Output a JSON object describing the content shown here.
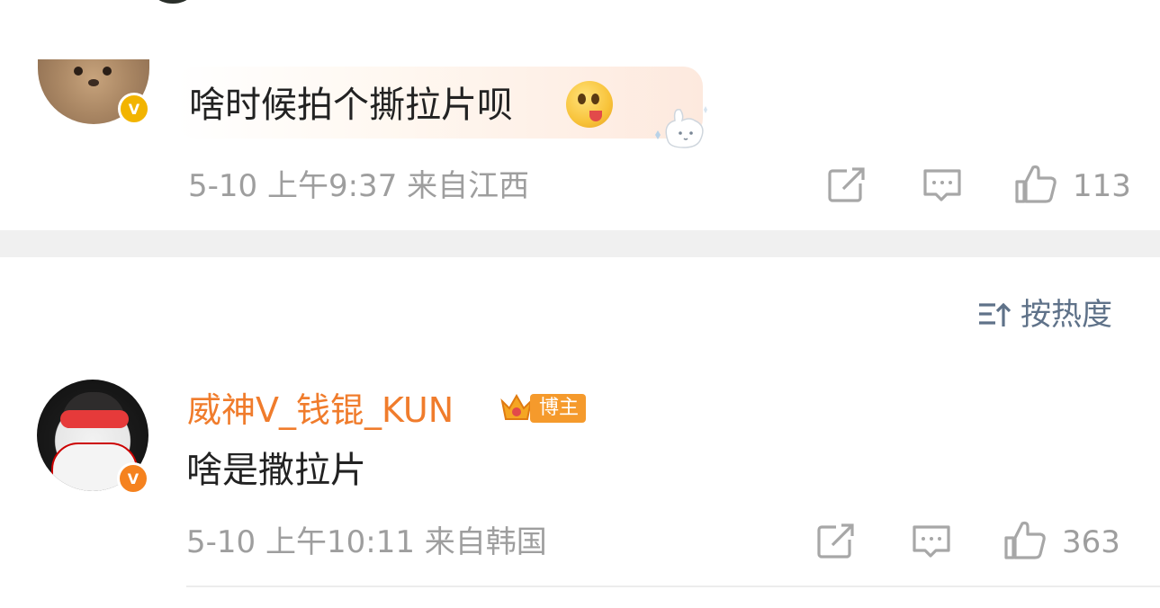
{
  "comments": [
    {
      "text": "啥时候拍个撕拉片呗",
      "time": "5-10 上午9:37",
      "location": "来自江西",
      "likes": "113"
    },
    {
      "username": "威神V_钱锟_KUN",
      "badge": "博主",
      "text": "啥是撒拉片",
      "time": "5-10 上午10:11",
      "location": "来自韩国",
      "likes": "363"
    }
  ],
  "sort": {
    "label": "按热度"
  },
  "verified_badge": "V",
  "icons": [
    "share-icon",
    "comment-icon",
    "like-icon",
    "sort-icon",
    "emoji-icon",
    "crown-icon"
  ],
  "colors": {
    "username": "#f07c2c",
    "meta": "#9e9e9e",
    "sort": "#5f7289",
    "badge": "#f59a2c",
    "band": "#f0f0f0"
  }
}
